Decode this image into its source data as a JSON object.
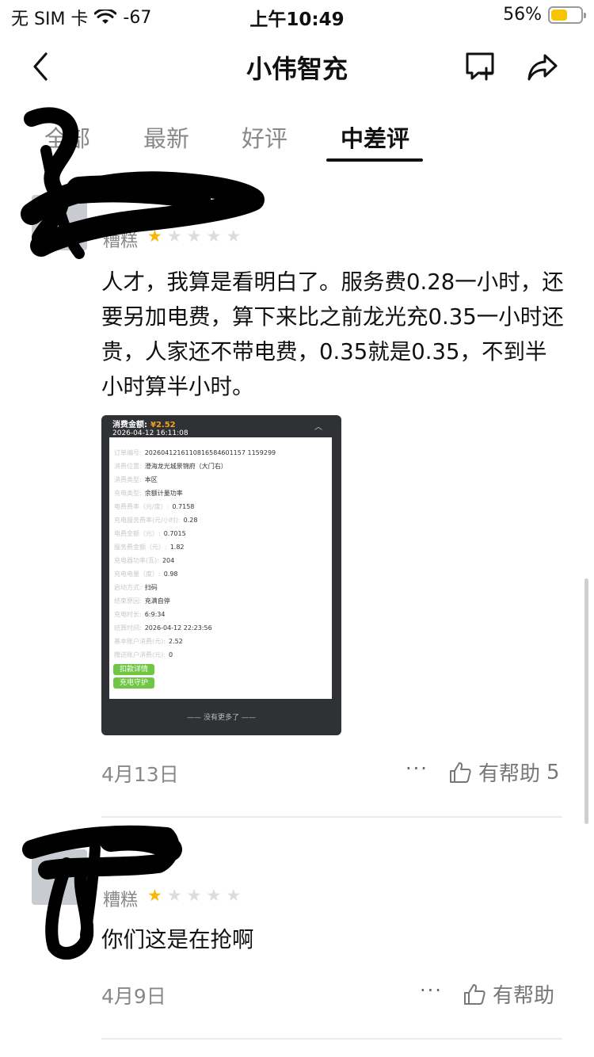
{
  "status_bar": {
    "carrier": "无 SIM 卡",
    "signal": "-67",
    "time": "上午10:49",
    "battery": "56%",
    "battery_level": 0.56,
    "battery_color": "#f6c500"
  },
  "nav": {
    "title": "小伟智充",
    "back_icon": "chevron-left-icon",
    "message_icon": "chat-add-icon",
    "share_icon": "share-arrow-icon"
  },
  "tabs": [
    {
      "label": "全部",
      "active": false
    },
    {
      "label": "最新",
      "active": false
    },
    {
      "label": "好评",
      "active": false
    },
    {
      "label": "中差评",
      "active": true
    }
  ],
  "reviews": [
    {
      "rating_label": "糟糕",
      "stars": 1,
      "text": "人才，我算是看明白了。服务费0.28一小时，还要另加电费，算下来比之前龙光充0.35一小时还贵，人家还不带电费，0.35就是0.35，不到半小时算半小时。",
      "date": "4月13日",
      "more": "···",
      "helpful_label": "有帮助",
      "helpful_count": "5",
      "attachment": {
        "title": "消费金额:",
        "amount": "¥2.52",
        "datetime": "2026-04-12 16:11:08",
        "rows": [
          {
            "label": "订单编号:",
            "value": "2026041216110816584601157 1159299"
          },
          {
            "label": "消费位置:",
            "value": "澄海龙光城景锦府（大门右）"
          },
          {
            "label": "消费类型:",
            "value": "本区"
          },
          {
            "label": "充电类型:",
            "value": "余额计量功率"
          },
          {
            "label": "电费费率（元/度）:",
            "value": "0.7158"
          },
          {
            "label": "充电服务费率(元/小时):",
            "value": "0.28"
          },
          {
            "label": "电费金额（元）:",
            "value": "0.7015"
          },
          {
            "label": "服务费金额（元）:",
            "value": "1.82"
          },
          {
            "label": "充电器功率(瓦):",
            "value": "204"
          },
          {
            "label": "充电电量（度）:",
            "value": "0.98"
          },
          {
            "label": "启动方式:",
            "value": "扫码"
          },
          {
            "label": "结束原因:",
            "value": "充满自停"
          },
          {
            "label": "充电时长:",
            "value": "6:9:34"
          },
          {
            "label": "结算时间:",
            "value": "2026-04-12 22:23:56"
          },
          {
            "label": "基本账户消费(元):",
            "value": "2.52"
          },
          {
            "label": "赠送账户消费(元):",
            "value": "0"
          }
        ],
        "btn_detail": "扣款详情",
        "btn_guard": "充电守护",
        "footer": "—— 没有更多了 ——"
      }
    },
    {
      "rating_label": "糟糕",
      "stars": 1,
      "text": "你们这是在抢啊",
      "date": "4月9日",
      "more": "···",
      "helpful_label": "有帮助",
      "helpful_count": ""
    }
  ]
}
